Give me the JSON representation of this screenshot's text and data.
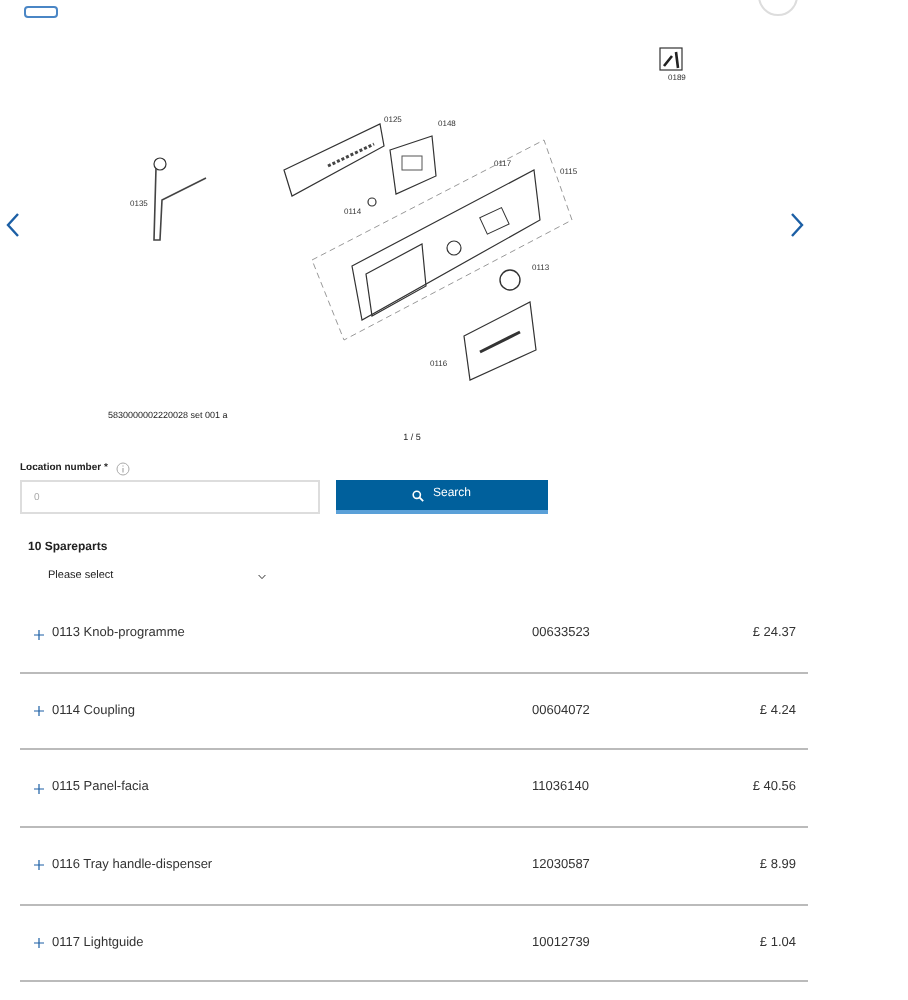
{
  "diagram": {
    "callouts": [
      "0189",
      "0125",
      "0148",
      "0135",
      "0117",
      "0115",
      "0114",
      "0113",
      "0116"
    ],
    "caption": "5830000002220028 set 001 a",
    "pager": "1 / 5"
  },
  "location": {
    "label": "Location number *",
    "placeholder": "0"
  },
  "search_button": "Search",
  "parts": {
    "count_label": "10 Spareparts",
    "sort": "Please select",
    "rows": [
      {
        "name": "0113 Knob-programme",
        "number": "00633523",
        "price": "£ 24.37"
      },
      {
        "name": "0114 Coupling",
        "number": "00604072",
        "price": "£ 4.24"
      },
      {
        "name": "0115 Panel-facia",
        "number": "11036140",
        "price": "£ 40.56"
      },
      {
        "name": "0116 Tray handle-dispenser",
        "number": "12030587",
        "price": "£ 8.99"
      },
      {
        "name": "0117 Lightguide",
        "number": "10012739",
        "price": "£ 1.04"
      }
    ]
  }
}
